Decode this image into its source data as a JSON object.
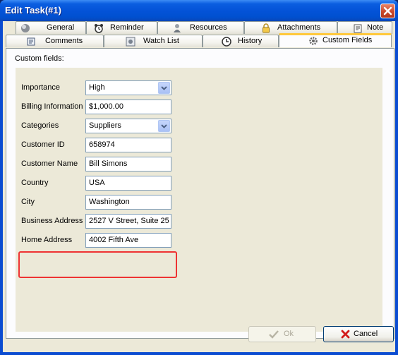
{
  "window": {
    "title": "Edit Task(#1)"
  },
  "tabs_row1": [
    {
      "label": "General",
      "icon": "sphere-icon"
    },
    {
      "label": "Reminder",
      "icon": "alarm-clock-icon"
    },
    {
      "label": "Resources",
      "icon": "person-icon"
    },
    {
      "label": "Attachments",
      "icon": "padlock-icon"
    },
    {
      "label": "Note",
      "icon": "note-icon"
    }
  ],
  "tabs_row2": [
    {
      "label": "Comments",
      "icon": "comments-icon"
    },
    {
      "label": "Watch List",
      "icon": "watch-list-icon"
    },
    {
      "label": "History",
      "icon": "history-icon"
    },
    {
      "label": "Custom Fields",
      "icon": "gear-icon",
      "active": true
    }
  ],
  "section_label": "Custom fields:",
  "fields": [
    {
      "label": "Importance",
      "value": "High",
      "type": "select"
    },
    {
      "label": "Billing Information",
      "value": "$1,000.00",
      "type": "text"
    },
    {
      "label": "Categories",
      "value": "Suppliers",
      "type": "select"
    },
    {
      "label": "Customer ID",
      "value": "658974",
      "type": "text"
    },
    {
      "label": "Customer Name",
      "value": "Bill Simons",
      "type": "text"
    },
    {
      "label": "Country",
      "value": "USA",
      "type": "text"
    },
    {
      "label": "City",
      "value": "Washington",
      "type": "text"
    },
    {
      "label": "Business Address",
      "value": "2527 V Street, Suite 25",
      "type": "text"
    },
    {
      "label": "Home Address",
      "value": "4002 Fifth Ave",
      "type": "text"
    }
  ],
  "buttons": {
    "ok": "Ok",
    "cancel": "Cancel"
  },
  "colors": {
    "highlight": "#e33333",
    "accent_tab": "#ffc83c"
  }
}
